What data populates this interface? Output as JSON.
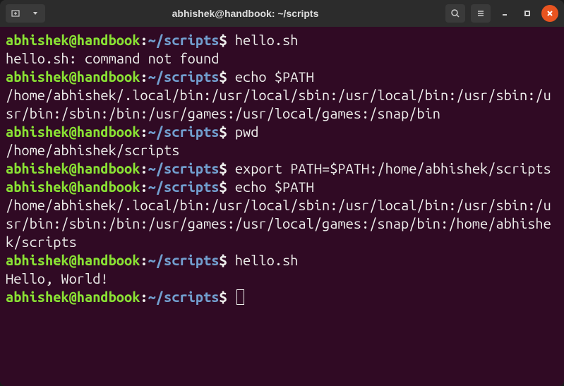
{
  "window": {
    "title": "abhishek@handbook: ~/scripts"
  },
  "prompt": {
    "user_host": "abhishek@handbook",
    "colon": ":",
    "path": "~/scripts",
    "dollar": "$"
  },
  "lines": [
    {
      "type": "prompt",
      "cmd": "hello.sh"
    },
    {
      "type": "output",
      "text": "hello.sh: command not found"
    },
    {
      "type": "prompt",
      "cmd": "echo $PATH"
    },
    {
      "type": "output",
      "text": "/home/abhishek/.local/bin:/usr/local/sbin:/usr/local/bin:/usr/sbin:/usr/bin:/sbin:/bin:/usr/games:/usr/local/games:/snap/bin"
    },
    {
      "type": "prompt",
      "cmd": "pwd"
    },
    {
      "type": "output",
      "text": "/home/abhishek/scripts"
    },
    {
      "type": "prompt",
      "cmd": "export PATH=$PATH:/home/abhishek/scripts"
    },
    {
      "type": "prompt",
      "cmd": "echo $PATH"
    },
    {
      "type": "output",
      "text": "/home/abhishek/.local/bin:/usr/local/sbin:/usr/local/bin:/usr/sbin:/usr/bin:/sbin:/bin:/usr/games:/usr/local/games:/snap/bin:/home/abhishek/scripts"
    },
    {
      "type": "prompt",
      "cmd": "hello.sh"
    },
    {
      "type": "output",
      "text": "Hello, World!"
    },
    {
      "type": "prompt",
      "cmd": "",
      "cursor": true
    }
  ]
}
